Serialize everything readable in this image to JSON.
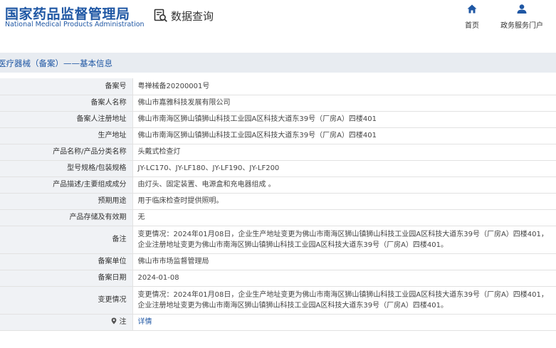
{
  "header": {
    "logo_cn": "国家药品监督管理局",
    "logo_en": "National Medical Products Administration",
    "search_title": "数据查询",
    "nav": [
      {
        "label": "首页",
        "icon": "home-icon"
      },
      {
        "label": "政务服务门户",
        "icon": "user-icon"
      }
    ]
  },
  "section": {
    "title": "医疗器械（备案）——基本信息"
  },
  "rows": [
    {
      "label": "备案号",
      "value": "粤禅械备20200001号"
    },
    {
      "label": "备案人名称",
      "value": "佛山市嘉雅科技发展有限公司"
    },
    {
      "label": "备案人注册地址",
      "value": "佛山市南海区狮山镇狮山科技工业园A区科技大道东39号（厂房A）四楼401"
    },
    {
      "label": "生产地址",
      "value": "佛山市南海区狮山镇狮山科技工业园A区科技大道东39号（厂房A）四楼401"
    },
    {
      "label": "产品名称/产品分类名称",
      "value": "头戴式检查灯"
    },
    {
      "label": "型号规格/包装规格",
      "value": "JY-LC170、JY-LF180、JY-LF190、JY-LF200"
    },
    {
      "label": "产品描述/主要组成成分",
      "value": "由灯头、固定装置、电源盒和充电器组成 。"
    },
    {
      "label": "预期用途",
      "value": "用于临床检查时提供照明。"
    },
    {
      "label": "产品存储及有效期",
      "value": "无"
    },
    {
      "label": "备注",
      "value": "变更情况：2024年01月08日，企业生产地址变更为佛山市南海区狮山镇狮山科技工业园A区科技大道东39号（厂房A）四楼401，企业注册地址变更为佛山市南海区狮山镇狮山科技工业园A区科技大道东39号（厂房A）四楼401。"
    },
    {
      "label": "备案单位",
      "value": "佛山市市场监督管理局"
    },
    {
      "label": "备案日期",
      "value": "2024-01-08"
    },
    {
      "label": "变更情况",
      "value": "变更情况：2024年01月08日，企业生产地址变更为佛山市南海区狮山镇狮山科技工业园A区科技大道东39号（厂房A）四楼401，企业注册地址变更为佛山市南海区狮山镇狮山科技工业园A区科技大道东39号（厂房A）四楼401。"
    }
  ],
  "note": {
    "label": "注",
    "link_text": "详情",
    "icon": "pin-icon"
  },
  "colors": {
    "brand": "#1f57a4",
    "section_bg": "#e8ecf1",
    "label_bg": "#f0f2f5"
  }
}
